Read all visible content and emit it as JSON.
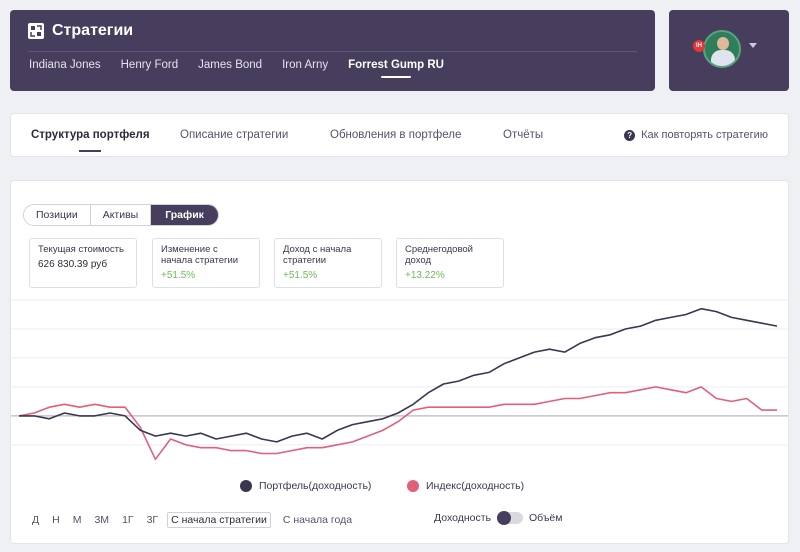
{
  "header": {
    "title": "Стратегии",
    "tabs": [
      "Indiana Jones",
      "Henry Ford",
      "James Bond",
      "Iron Arny",
      "Forrest Gump RU"
    ],
    "active_tab": "Forrest Gump RU"
  },
  "user": {
    "avatar_badge": "IH"
  },
  "nav": {
    "tabs": [
      "Структура портфеля",
      "Описание стратегии",
      "Обновления в портфеле",
      "Отчёты"
    ],
    "active_tab": "Структура портфеля",
    "help_label": "Как повторять стратегию"
  },
  "view_switch": {
    "options": [
      "Позиции",
      "Активы",
      "График"
    ],
    "active": "График"
  },
  "stats": [
    {
      "label": "Текущая стоимость",
      "value": "626 830.39 руб",
      "positive": false
    },
    {
      "label": "Изменение с начала стратегии",
      "value": "+51.5%",
      "positive": true
    },
    {
      "label": "Доход с начала стратегии",
      "value": "+51.5%",
      "positive": true
    },
    {
      "label": "Среднегодовой доход",
      "value": "+13.22%",
      "positive": true
    }
  ],
  "legend": {
    "portfolio": "Портфель(доходность)",
    "index": "Индекс(доходность)"
  },
  "periods": {
    "options": [
      "Д",
      "Н",
      "М",
      "3М",
      "1Г",
      "3Г",
      "С начала стратегии",
      "С начала года"
    ],
    "active": "С начала стратегии"
  },
  "toggle": {
    "left_label": "Доходность",
    "right_label": "Объём"
  },
  "colors": {
    "portfolio": "#3a3650",
    "index": "#e0607a",
    "accent": "#463e5c",
    "positive": "#6fbb5c"
  },
  "chart_data": {
    "type": "line",
    "x": [
      0,
      3,
      6,
      9,
      12,
      15,
      18,
      21,
      24,
      27,
      30,
      33,
      36,
      39,
      42,
      45,
      48,
      51,
      54,
      57,
      60,
      63,
      66,
      69,
      72,
      75,
      78,
      81,
      84,
      87,
      90,
      93,
      96,
      99,
      102,
      105,
      108,
      111,
      114,
      117,
      120,
      123,
      126,
      129,
      132,
      135,
      138,
      141,
      144,
      147,
      150
    ],
    "series": [
      {
        "name": "Портфель(доходность)",
        "values": [
          0,
          0,
          -1,
          1,
          0,
          0,
          1,
          0,
          -5,
          -7,
          -6,
          -7,
          -6,
          -8,
          -7,
          -6,
          -8,
          -9,
          -7,
          -6,
          -8,
          -5,
          -3,
          -2,
          -1,
          1,
          4,
          8,
          11,
          12,
          14,
          15,
          18,
          20,
          22,
          23,
          22,
          25,
          27,
          28,
          30,
          31,
          33,
          34,
          35,
          37,
          36,
          34,
          33,
          32,
          31
        ]
      },
      {
        "name": "Индекс(доходность)",
        "values": [
          0,
          1,
          3,
          4,
          3,
          4,
          3,
          3,
          -4,
          -15,
          -8,
          -10,
          -11,
          -11,
          -12,
          -12,
          -13,
          -13,
          -12,
          -11,
          -11,
          -10,
          -9,
          -7,
          -5,
          -2,
          2,
          3,
          3,
          3,
          3,
          3,
          4,
          4,
          4,
          5,
          6,
          6,
          7,
          8,
          8,
          9,
          10,
          9,
          8,
          10,
          6,
          5,
          6,
          2,
          2
        ]
      }
    ],
    "xlabel": "",
    "ylabel": "",
    "grid": true,
    "legend_position": "bottom-center"
  }
}
